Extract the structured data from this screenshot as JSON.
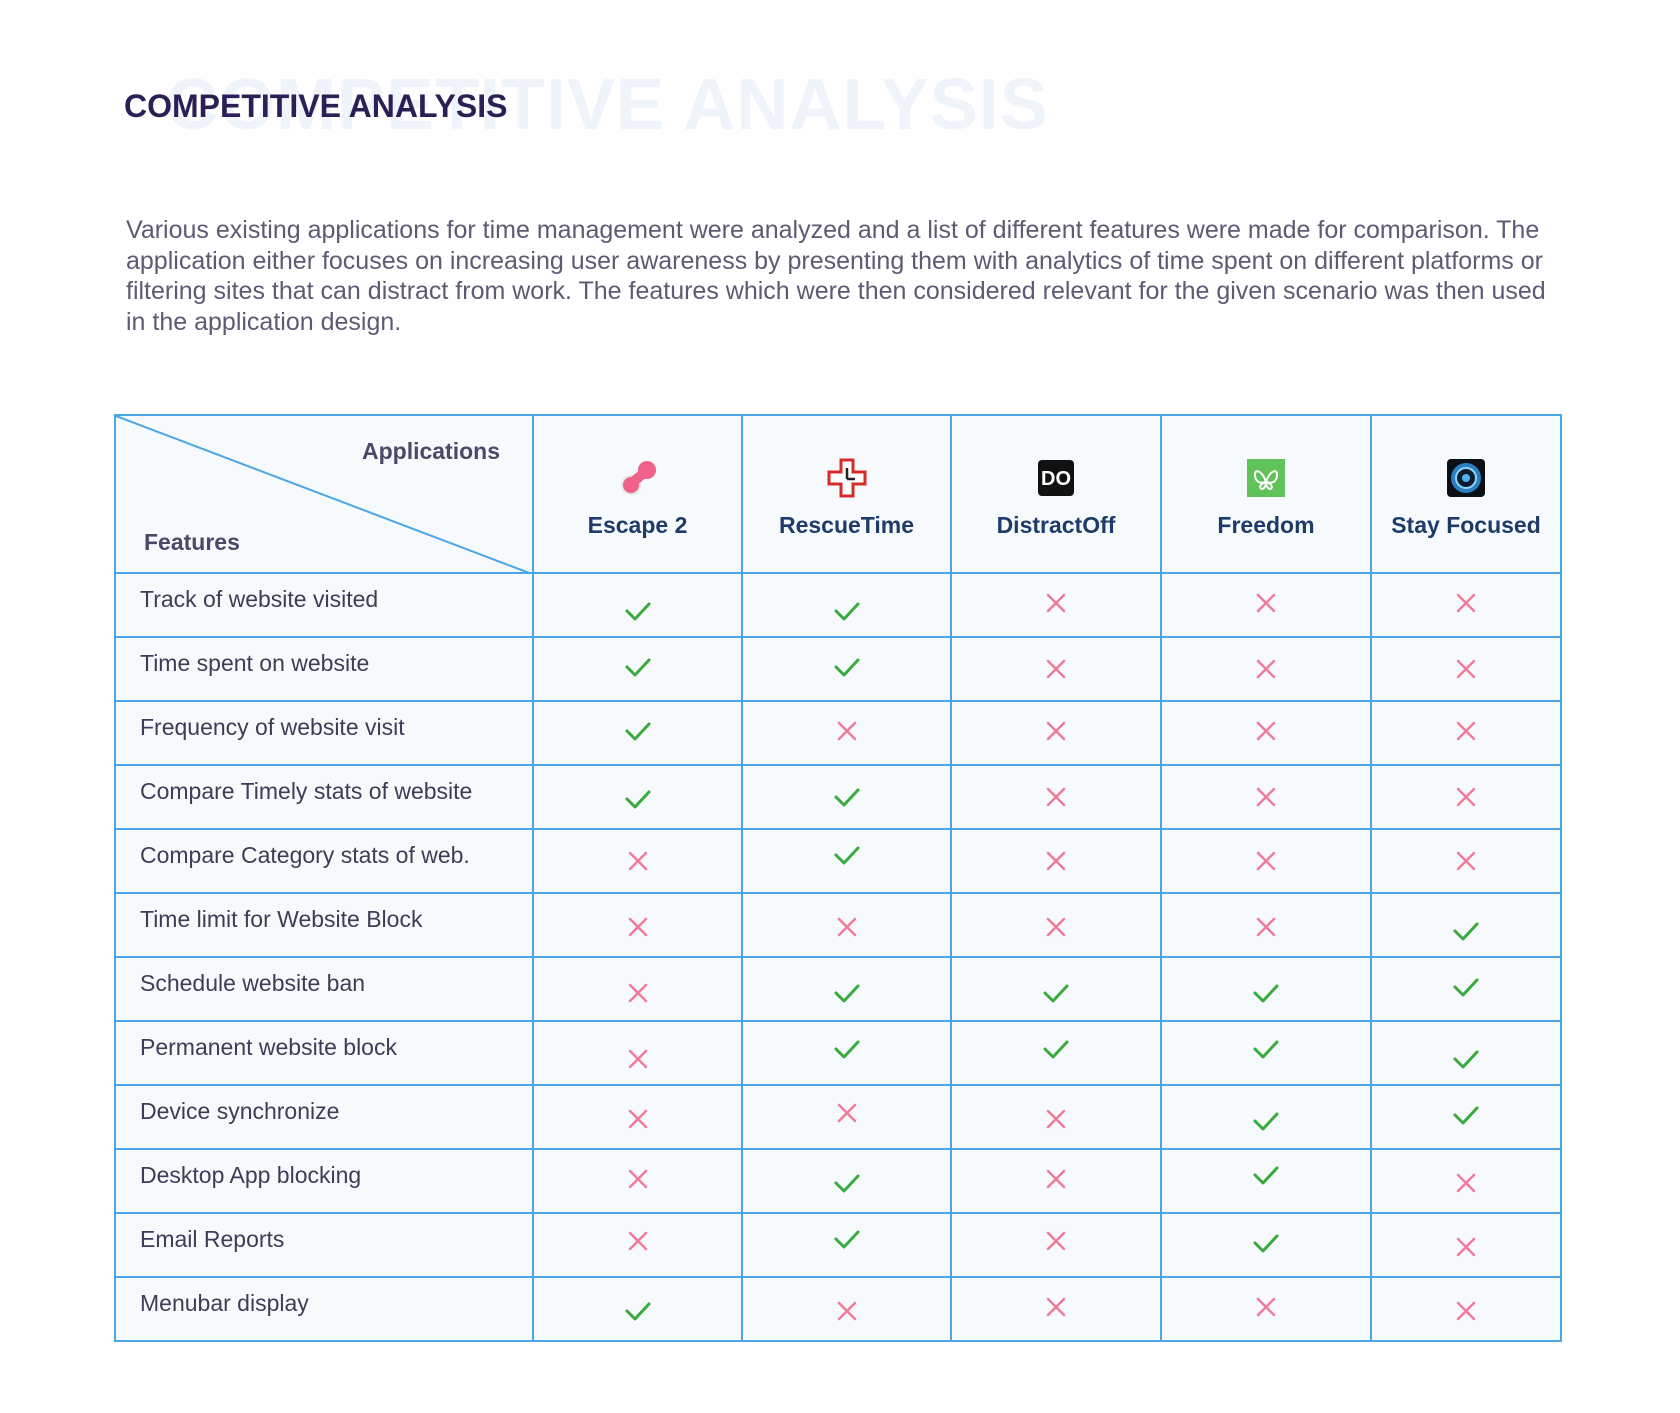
{
  "page": {
    "title": "COMPETITIVE ANALYSIS",
    "title_ghost": "COMPETITIVE ANALYSIS",
    "intro": "Various existing applications for time management were analyzed and a list of different features were made for comparison. The application either focuses on increasing user awareness by presenting them with analytics of time spent on different platforms or filtering sites that can distract from work. The features which were then considered relevant for the given scenario was then used in the application design."
  },
  "table": {
    "corner_top_label": "Applications",
    "corner_bottom_label": "Features",
    "apps": [
      {
        "name": "Escape 2",
        "icon": "escape2-logo-icon"
      },
      {
        "name": "RescueTime",
        "icon": "rescuetime-logo-icon"
      },
      {
        "name": "DistractOff",
        "icon": "distractoff-logo-icon",
        "icon_text": "DO"
      },
      {
        "name": "Freedom",
        "icon": "freedom-logo-icon"
      },
      {
        "name": "Stay Focused",
        "icon": "stayfocused-logo-icon"
      }
    ],
    "rows": [
      {
        "feature": "Track of website visited",
        "values": [
          true,
          true,
          false,
          false,
          false
        ]
      },
      {
        "feature": "Time spent on website",
        "values": [
          true,
          true,
          false,
          false,
          false
        ]
      },
      {
        "feature": "Frequency of website visit",
        "values": [
          true,
          false,
          false,
          false,
          false
        ]
      },
      {
        "feature": "Compare Timely stats of website",
        "values": [
          true,
          true,
          false,
          false,
          false
        ]
      },
      {
        "feature": "Compare Category stats of web.",
        "values": [
          false,
          true,
          false,
          false,
          false
        ]
      },
      {
        "feature": "Time limit for Website Block",
        "values": [
          false,
          false,
          false,
          false,
          true
        ]
      },
      {
        "feature": "Schedule website ban",
        "values": [
          false,
          true,
          true,
          true,
          true
        ]
      },
      {
        "feature": "Permanent website block",
        "values": [
          false,
          true,
          true,
          true,
          true
        ]
      },
      {
        "feature": "Device synchronize",
        "values": [
          false,
          false,
          false,
          true,
          true
        ]
      },
      {
        "feature": "Desktop App blocking",
        "values": [
          false,
          true,
          false,
          true,
          false
        ]
      },
      {
        "feature": "Email Reports",
        "values": [
          false,
          true,
          false,
          true,
          false
        ]
      },
      {
        "feature": "Menubar display",
        "values": [
          true,
          false,
          false,
          false,
          false
        ]
      }
    ]
  },
  "colors": {
    "check": "#3aaa3f",
    "cross": "#f27a9a",
    "grid_line": "#4aa6e4",
    "title": "#2b1f55"
  }
}
